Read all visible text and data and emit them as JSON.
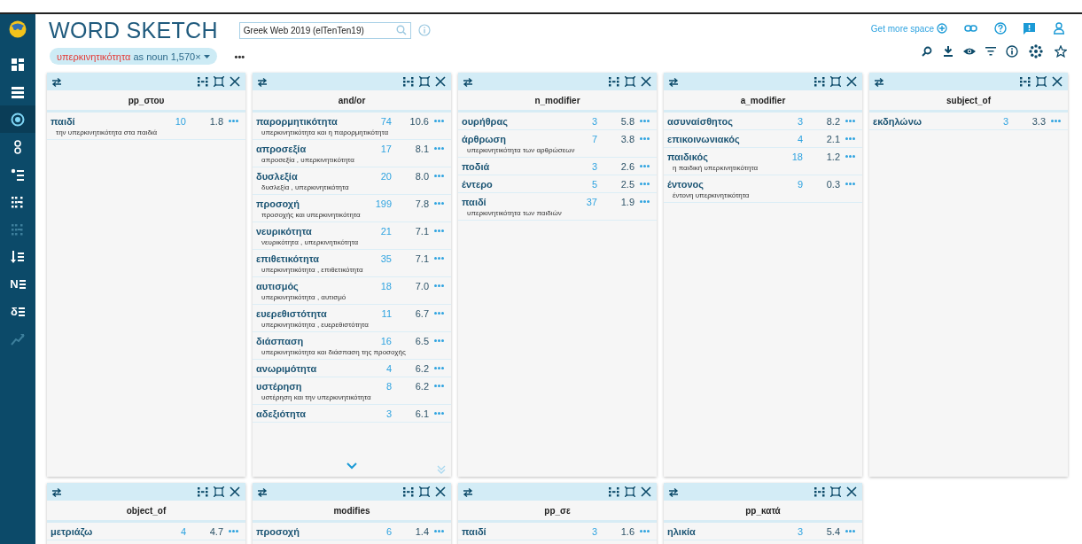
{
  "sidebar": {
    "items": [
      {
        "kind": "grid",
        "selected": false,
        "disabled": false
      },
      {
        "kind": "list",
        "selected": false,
        "disabled": false
      },
      {
        "kind": "target",
        "selected": true,
        "disabled": false
      },
      {
        "kind": "glasses",
        "selected": false,
        "disabled": false
      },
      {
        "kind": "bullets",
        "selected": false,
        "disabled": false
      },
      {
        "kind": "dots",
        "selected": false,
        "disabled": false
      },
      {
        "kind": "dots",
        "selected": false,
        "disabled": true
      },
      {
        "kind": "sort",
        "selected": false,
        "disabled": false
      },
      {
        "kind": "letter",
        "glyph": "N",
        "selected": false,
        "disabled": false
      },
      {
        "kind": "letter",
        "glyph": "δ",
        "selected": false,
        "disabled": false
      },
      {
        "kind": "trend",
        "selected": false,
        "disabled": true
      }
    ]
  },
  "header": {
    "title": "WORD SKETCH",
    "corpus": {
      "value": "Greek Web 2019 (elTenTen19)"
    },
    "query": {
      "lemma": "υπερκινητικότητα",
      "pos": "as noun",
      "frequency": "1,570×"
    },
    "more": "•••",
    "get_more_space": "Get more space"
  },
  "cards": [
    {
      "title": "pp_στου",
      "show_more": false,
      "rows": [
        {
          "word": "παιδί",
          "freq": "10",
          "score": "1.8",
          "example": "την υπερκινητικότητα στα παιδιά"
        }
      ]
    },
    {
      "title": "and/or",
      "show_more": true,
      "rows": [
        {
          "word": "παρορμητικότητα",
          "freq": "74",
          "score": "10.6",
          "example": "υπερκινητικότητα και η παρορμητικότητα"
        },
        {
          "word": "απροσεξία",
          "freq": "17",
          "score": "8.1",
          "example": "απροσεξία , υπερκινητικότητα"
        },
        {
          "word": "δυσλεξία",
          "freq": "20",
          "score": "8.0",
          "example": "δυσλεξία , υπερκινητικότητα"
        },
        {
          "word": "προσοχή",
          "freq": "199",
          "score": "7.8",
          "example": "προσοχής και υπερκινητικότητα"
        },
        {
          "word": "νευρικότητα",
          "freq": "21",
          "score": "7.1",
          "example": "νευρικότητα , υπερκινητικότητα"
        },
        {
          "word": "επιθετικότητα",
          "freq": "35",
          "score": "7.1",
          "example": "υπερκινητικότητα , επιθετικότητα"
        },
        {
          "word": "αυτισμός",
          "freq": "18",
          "score": "7.0",
          "example": "υπερκινητικότητα , αυτισμό"
        },
        {
          "word": "ευερεθιστότητα",
          "freq": "11",
          "score": "6.7",
          "example": "υπερκινητικότητα , ευερεθιστότητα"
        },
        {
          "word": "διάσπαση",
          "freq": "16",
          "score": "6.5",
          "example": "υπερκινητικότητα και διάσπαση της προσοχής"
        },
        {
          "word": "ανωριμότητα",
          "freq": "4",
          "score": "6.2"
        },
        {
          "word": "υστέρηση",
          "freq": "8",
          "score": "6.2",
          "example": "υστέρηση και την υπερκινητικότητα"
        },
        {
          "word": "αδεξιότητα",
          "freq": "3",
          "score": "6.1"
        }
      ]
    },
    {
      "title": "n_modifier",
      "show_more": false,
      "rows": [
        {
          "word": "ουρήθρας",
          "freq": "3",
          "score": "5.8"
        },
        {
          "word": "άρθρωση",
          "freq": "7",
          "score": "3.8",
          "example": "υπερκινητικότητα των αρθρώσεων"
        },
        {
          "word": "ποδιά",
          "freq": "3",
          "score": "2.6"
        },
        {
          "word": "έντερο",
          "freq": "5",
          "score": "2.5"
        },
        {
          "word": "παιδί",
          "freq": "37",
          "score": "1.9",
          "example": "υπερκινητικότητα των παιδιών"
        }
      ]
    },
    {
      "title": "a_modifier",
      "show_more": false,
      "rows": [
        {
          "word": "ασυναίσθητος",
          "freq": "3",
          "score": "8.2"
        },
        {
          "word": "επικοινωνιακός",
          "freq": "4",
          "score": "2.1"
        },
        {
          "word": "παιδικός",
          "freq": "18",
          "score": "1.2",
          "example": "η παιδική υπερκινητικότητα"
        },
        {
          "word": "έντονος",
          "freq": "9",
          "score": "0.3",
          "example": "έντονη υπερκινητικότητα"
        }
      ]
    },
    {
      "title": "subject_of",
      "show_more": false,
      "rows": [
        {
          "word": "εκδηλώνω",
          "freq": "3",
          "score": "3.3"
        }
      ]
    },
    {
      "title": "object_of",
      "show_more": false,
      "rows": [
        {
          "word": "μετριάζω",
          "freq": "4",
          "score": "4.7"
        }
      ]
    },
    {
      "title": "modifies",
      "show_more": false,
      "rows": [
        {
          "word": "προσοχή",
          "freq": "6",
          "score": "1.4"
        }
      ]
    },
    {
      "title": "pp_σε",
      "show_more": false,
      "rows": [
        {
          "word": "παιδί",
          "freq": "3",
          "score": "1.6"
        }
      ]
    },
    {
      "title": "pp_κατά",
      "show_more": false,
      "rows": [
        {
          "word": "ηλικία",
          "freq": "3",
          "score": "5.4"
        }
      ]
    }
  ]
}
